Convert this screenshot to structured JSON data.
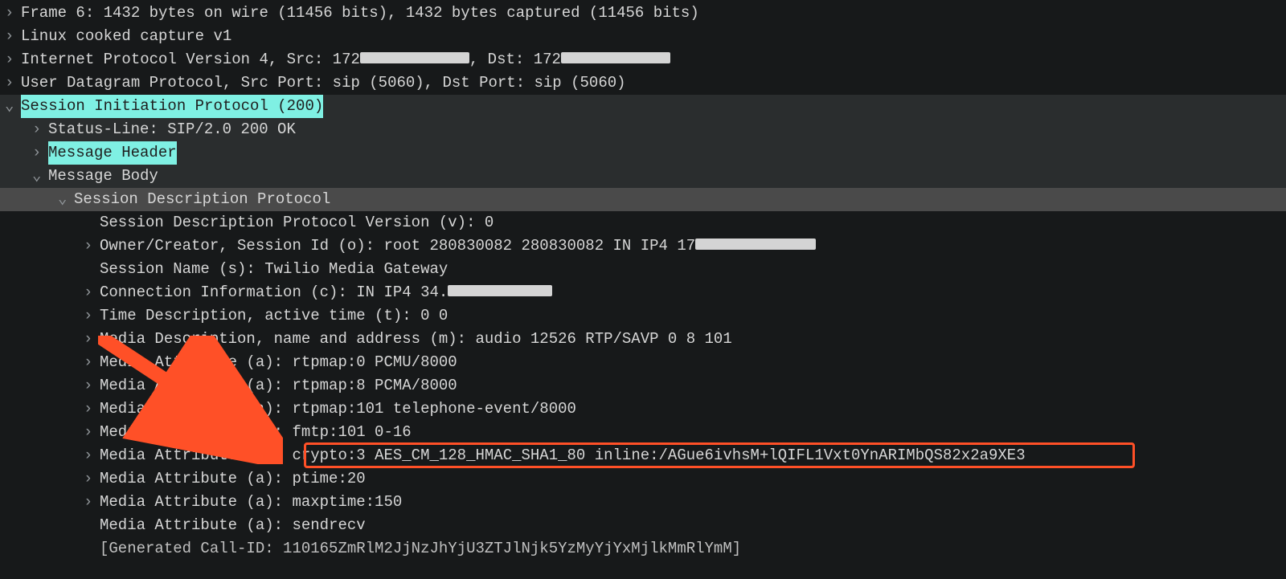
{
  "rows": {
    "frame": "Frame 6: 1432 bytes on wire (11456 bits), 1432 bytes captured (11456 bits)",
    "linux": "Linux cooked capture v1",
    "ip_pre": "Internet Protocol Version 4, Src: 172",
    "ip_mid": ", Dst: 172",
    "udp": "User Datagram Protocol, Src Port: sip (5060), Dst Port: sip (5060)",
    "sip": "Session Initiation Protocol (200)",
    "status": "Status-Line: SIP/2.0 200 OK",
    "msghdr": "Message Header",
    "msgbody": "Message Body",
    "sdp": "Session Description Protocol",
    "sdp_v": "Session Description Protocol Version (v): 0",
    "sdp_o_a": "Owner/Creator, Session Id (o): root 280830082 280830082 IN IP4 17",
    "sdp_s": "Session Name (s): Twilio Media Gateway",
    "sdp_c_a": "Connection Information (c): IN IP4 34.",
    "sdp_t": "Time Description, active time (t): 0 0",
    "sdp_m": "Media Description, name and address (m): audio 12526 RTP/SAVP 0 8 101",
    "sdp_a1": "Media Attribute (a): rtpmap:0 PCMU/8000",
    "sdp_a2": "Media Attribute (a): rtpmap:8 PCMA/8000",
    "sdp_a3": "Media Attribute (a): rtpmap:101 telephone-event/8000",
    "sdp_a4": "Media Attribute (a): fmtp:101 0-16",
    "sdp_a5a": "Media Attribute (a): ",
    "sdp_a5b": "crypto:3 AES_CM_128_HMAC_SHA1_80 inline:/AGue6ivhsM+lQIFL1Vxt0YnARIMbQS82x2a9XE3",
    "sdp_a6": "Media Attribute (a): ptime:20",
    "sdp_a7": "Media Attribute (a): maxptime:150",
    "sdp_a8": "Media Attribute (a): sendrecv",
    "sdp_cid": "[Generated Call-ID: 110165ZmRlM2JjNzJhYjU3ZTJlNjk5YzMyYjYxMjlkMmRlYmM]"
  },
  "arrow_glyph_right": "›",
  "arrow_glyph_down": "⌄"
}
